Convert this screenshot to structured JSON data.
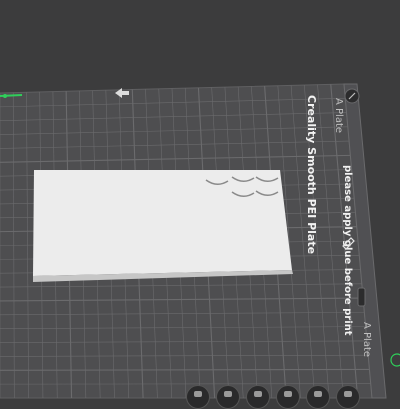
{
  "viewport": {
    "background": "#3c3c3d",
    "bed": {
      "plate_name": "Creality Smooth PEI Plate",
      "plate_note": "please apply glue before print",
      "tab_top_label": "A Plate",
      "tab_bottom_label": "A Plate",
      "bed_color": "#4e4e50",
      "grid_color": "#6b6b6d",
      "axis_color": "#2fcf5a"
    },
    "model": {
      "name": "rectangular plate with holes",
      "color": "#ececec"
    },
    "icons": [
      "edit-icon",
      "settings-icon",
      "move-icon"
    ]
  },
  "toolbar": {
    "buttons": [
      "orient",
      "arrange",
      "split",
      "layers",
      "settings",
      "more"
    ]
  }
}
